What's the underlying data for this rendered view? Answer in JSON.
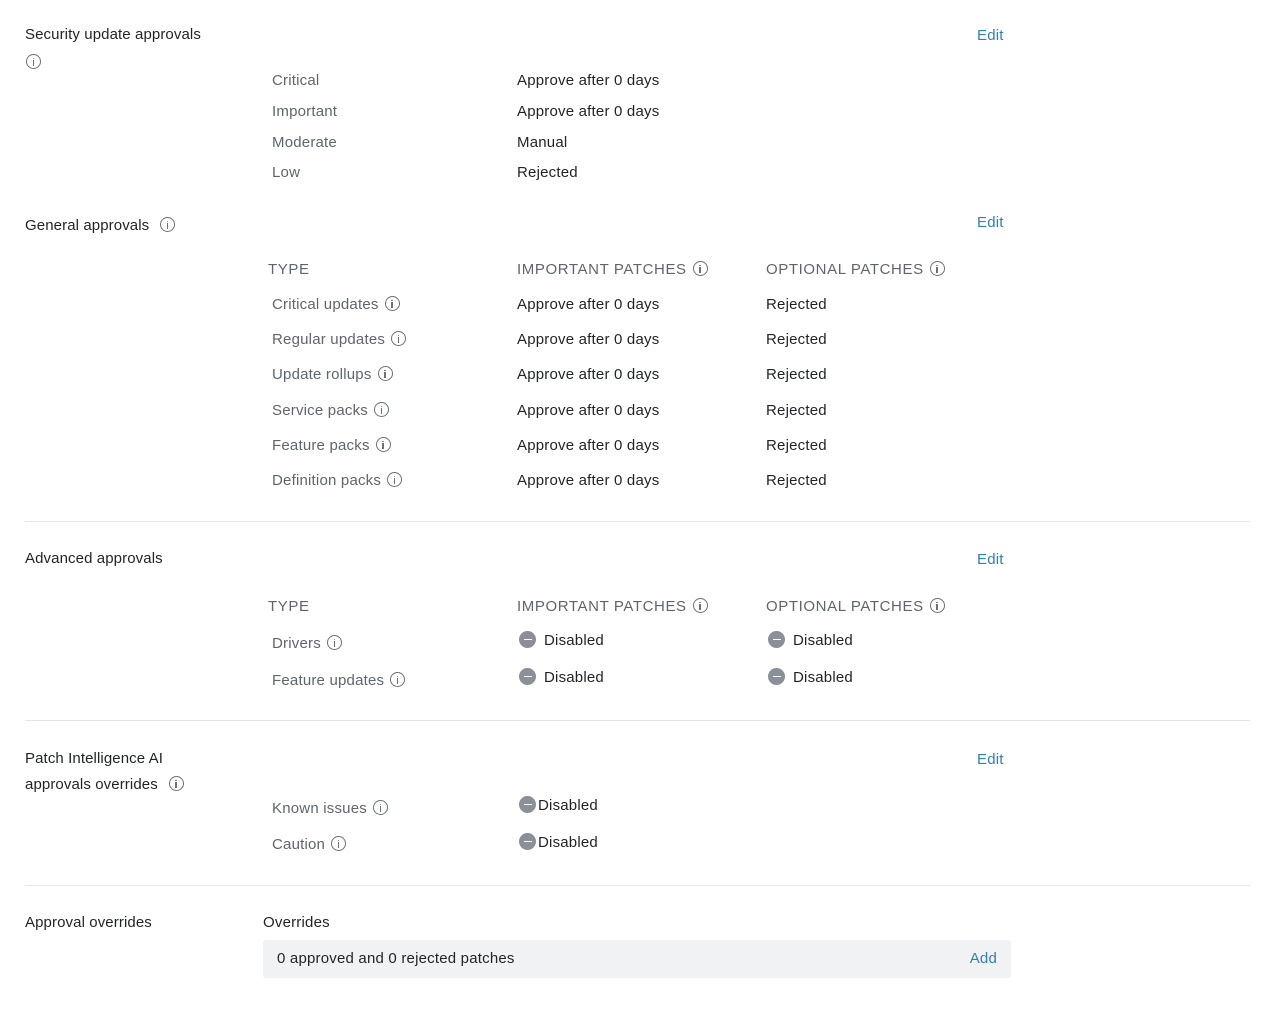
{
  "security": {
    "title": "Security update approvals",
    "edit": "Edit",
    "rows": [
      {
        "label": "Critical",
        "value": "Approve after 0 days"
      },
      {
        "label": "Important",
        "value": "Approve after 0 days"
      },
      {
        "label": "Moderate",
        "value": "Manual"
      },
      {
        "label": "Low",
        "value": "Rejected"
      }
    ]
  },
  "general": {
    "title": "General approvals",
    "edit": "Edit",
    "headers": {
      "type": "TYPE",
      "important": "IMPORTANT PATCHES",
      "optional": "OPTIONAL PATCHES"
    },
    "rows": [
      {
        "label": "Critical updates",
        "important": "Approve after 0 days",
        "optional": "Rejected"
      },
      {
        "label": "Regular updates",
        "important": "Approve after 0 days",
        "optional": "Rejected"
      },
      {
        "label": "Update rollups",
        "important": "Approve after 0 days",
        "optional": "Rejected"
      },
      {
        "label": "Service packs",
        "important": "Approve after 0 days",
        "optional": "Rejected"
      },
      {
        "label": "Feature packs",
        "important": "Approve after 0 days",
        "optional": "Rejected"
      },
      {
        "label": "Definition packs",
        "important": "Approve after 0 days",
        "optional": "Rejected"
      }
    ]
  },
  "advanced": {
    "title": "Advanced approvals",
    "edit": "Edit",
    "headers": {
      "type": "TYPE",
      "important": "IMPORTANT PATCHES",
      "optional": "OPTIONAL PATCHES"
    },
    "rows": [
      {
        "label": "Drivers",
        "important": "Disabled",
        "optional": "Disabled"
      },
      {
        "label": "Feature updates",
        "important": "Disabled",
        "optional": "Disabled"
      }
    ]
  },
  "ai": {
    "title_line1": "Patch Intelligence AI",
    "title_line2": "approvals overrides",
    "edit": "Edit",
    "rows": [
      {
        "label": "Known issues",
        "value": "Disabled"
      },
      {
        "label": "Caution",
        "value": "Disabled"
      }
    ]
  },
  "overrides": {
    "title": "Approval overrides",
    "subtitle": "Overrides",
    "summary": "0 approved and 0 rejected patches",
    "add": "Add"
  },
  "icons": {
    "info": "info-circle-icon",
    "disabled": "minus-circle-icon"
  },
  "colors": {
    "link": "#2f7fb8",
    "disabled_icon": "#8a8f98",
    "divider": "#e4e6ea",
    "box_bg": "#f1f2f4"
  }
}
